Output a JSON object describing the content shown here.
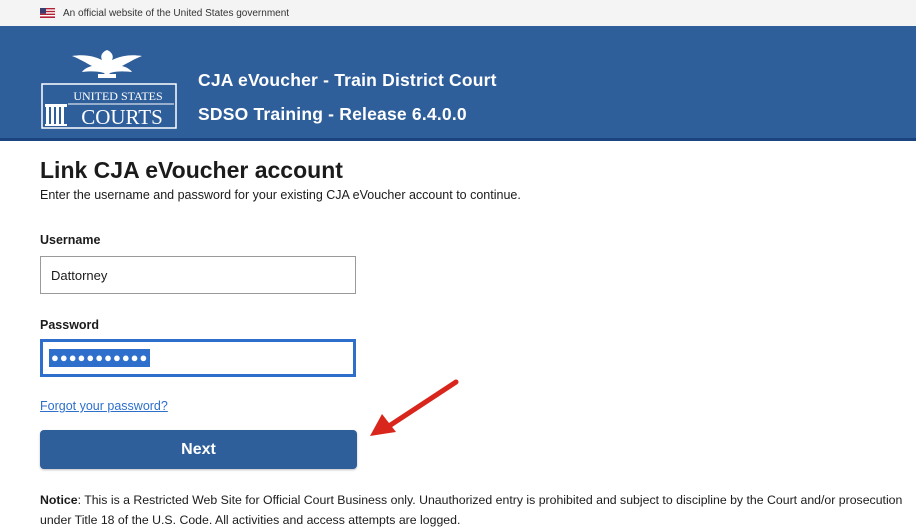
{
  "gov_banner": {
    "text": "An official website of the United States government",
    "flag_icon": "us-flag-icon"
  },
  "header": {
    "logo_line1": "UNITED STATES",
    "logo_line2": "COURTS",
    "logo_icon": "eagle-icon",
    "title": "CJA eVoucher - Train District Court",
    "subtitle": "SDSO Training - Release 6.4.0.0",
    "background_color": "#2f5f9b"
  },
  "main": {
    "page_title": "Link CJA eVoucher account",
    "instructions": "Enter the username and password for your existing CJA eVoucher account to continue.",
    "username": {
      "label": "Username",
      "value": "Dattorney"
    },
    "password": {
      "label": "Password",
      "masked_value": "●●●●●●●●●●●"
    },
    "forgot_password_link": "Forgot your password?",
    "next_button": "Next",
    "annotation_icon": "red-arrow-icon"
  },
  "notice": {
    "label": "Notice",
    "text": ": This is a Restricted Web Site for Official Court Business only. Unauthorized entry is prohibited and subject to discipline by the Court and/or prosecution under Title 18 of the U.S. Code. All activities and access attempts are logged."
  },
  "colors": {
    "primary": "#2f5f9b",
    "link": "#2e6fcc",
    "annotation_arrow": "#d9261c"
  }
}
